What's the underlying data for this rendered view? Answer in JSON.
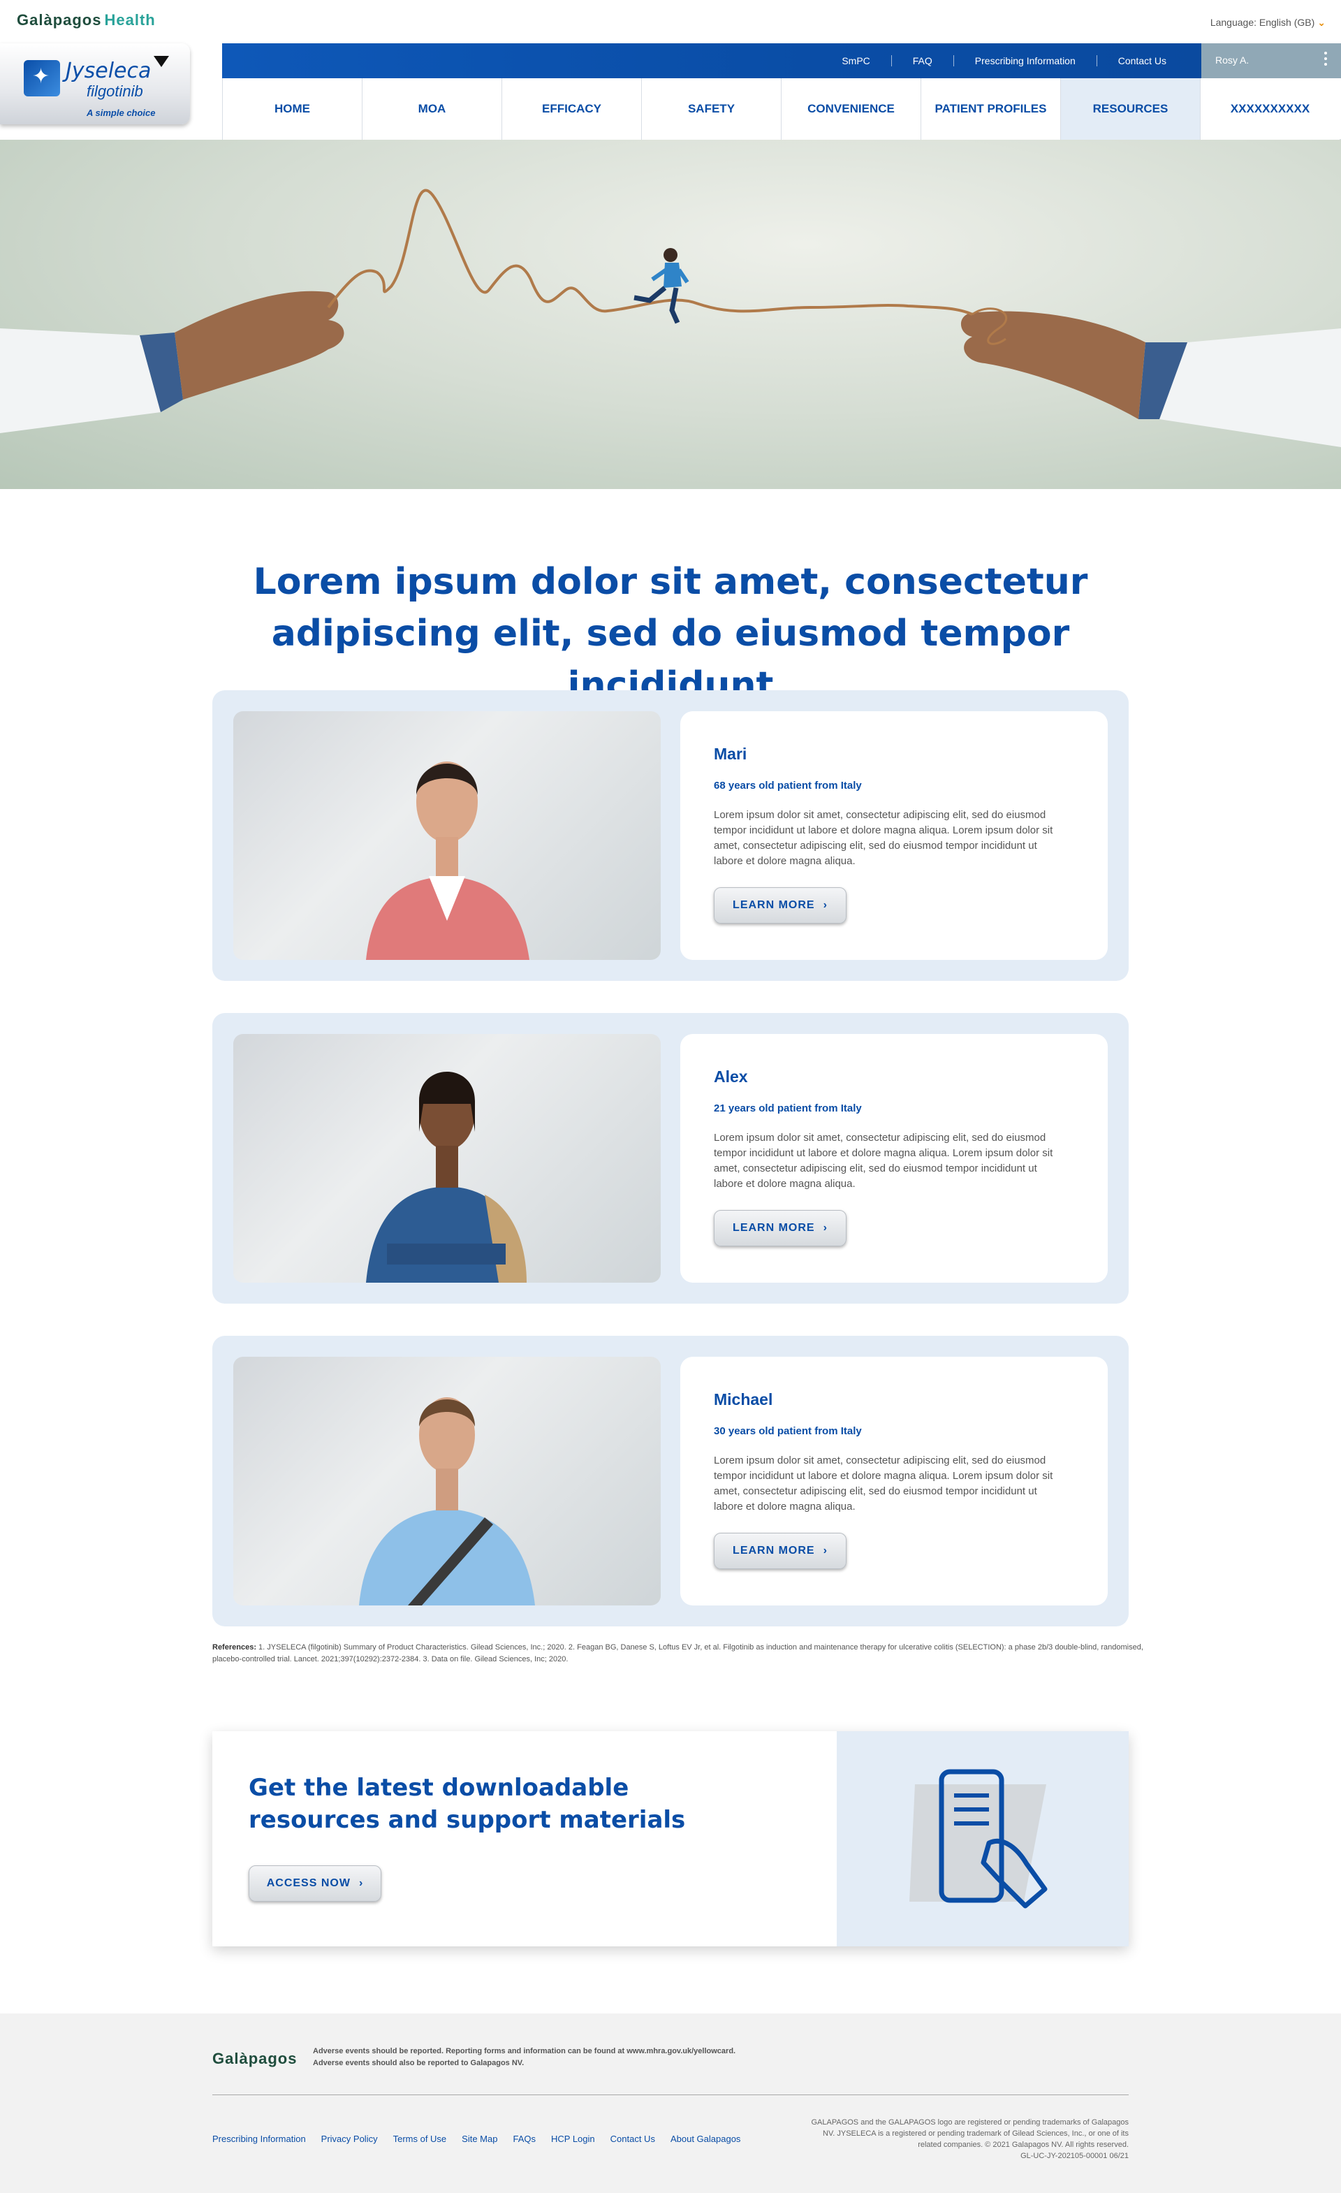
{
  "topbar": {
    "brand_left": "Galàpagos",
    "brand_right": "Health",
    "language": "Language: English (GB)"
  },
  "product_logo": {
    "name": "Jyseleca",
    "generic": "filgotinib",
    "tagline": "A simple choice"
  },
  "utility_nav": {
    "links": [
      "SmPC",
      "FAQ",
      "Prescribing Information",
      "Contact Us"
    ],
    "user": "Rosy A."
  },
  "main_nav": {
    "items": [
      "HOME",
      "MOA",
      "EFFICACY",
      "SAFETY",
      "CONVENIENCE",
      "PATIENT PROFILES",
      "RESOURCES",
      "XXXXXXXXXX"
    ],
    "active": "RESOURCES"
  },
  "main": {
    "heading": "Lorem ipsum dolor sit amet, consectetur adipiscing elit, sed do eiusmod tempor incididunt",
    "patients": [
      {
        "name": "Mari",
        "age": "68 years old patient from Italy",
        "desc": "Lorem ipsum dolor sit amet, consectetur adipiscing elit, sed do eiusmod tempor incididunt ut labore et dolore magna aliqua. Lorem ipsum dolor sit amet, consectetur adipiscing elit, sed do eiusmod tempor incididunt ut labore et dolore magna aliqua.",
        "button": "LEARN MORE"
      },
      {
        "name": "Alex",
        "age": "21 years old patient from Italy",
        "desc": "Lorem ipsum dolor sit amet, consectetur adipiscing elit, sed do eiusmod tempor incididunt ut labore et dolore magna aliqua. Lorem ipsum dolor sit amet, consectetur adipiscing elit, sed do eiusmod tempor incididunt ut labore et dolore magna aliqua.",
        "button": "LEARN MORE"
      },
      {
        "name": "Michael",
        "age": "30 years old patient from Italy",
        "desc": "Lorem ipsum dolor sit amet, consectetur adipiscing elit, sed do eiusmod tempor incididunt ut labore et dolore magna aliqua. Lorem ipsum dolor sit amet, consectetur adipiscing elit, sed do eiusmod tempor incididunt ut labore et dolore magna aliqua.",
        "button": "LEARN MORE"
      }
    ],
    "references_label": "References:",
    "references": "1. JYSELECA (filgotinib) Summary of Product Characteristics. Gilead Sciences, Inc.; 2020. 2. Feagan BG, Danese S, Loftus EV Jr, et al. Filgotinib as induction and maintenance therapy for ulcerative colitis (SELECTION): a phase 2b/3 double-blind, randomised, placebo-controlled trial. Lancet. 2021;397(10292):2372-2384. 3. Data on file. Gilead Sciences, Inc; 2020."
  },
  "download": {
    "heading": "Get the latest downloadable resources and support materials",
    "button": "ACCESS NOW"
  },
  "footer": {
    "logo": "Galàpagos",
    "adverse_1": "Adverse events should be reported. Reporting forms and information can be found at www.mhra.gov.uk/yellowcard.",
    "adverse_2": "Adverse events should also be reported to Galapagos NV.",
    "links": [
      "Prescribing Information",
      "Privacy Policy",
      "Terms of Use",
      "Site Map",
      "FAQs",
      "HCP Login",
      "Contact Us",
      "About Galapagos"
    ],
    "legal": "GALAPAGOS and the GALAPAGOS logo are registered or pending trademarks of Galapagos NV. JYSELECA is a registered or pending trademark of Gilead Sciences, Inc., or one of its related companies. © 2021 Galapagos NV. All rights reserved.",
    "code": "GL-UC-JY-202105-00001 06/21"
  },
  "colors": {
    "brand_blue": "#0a4da6",
    "light_panel": "#e3ecf6",
    "user_box": "#90a8b6",
    "accent_orange": "#e68a00"
  },
  "icons": [
    "chevron-down-icon",
    "kebab-menu-icon",
    "chevron-right-icon",
    "phone-document-icon"
  ]
}
